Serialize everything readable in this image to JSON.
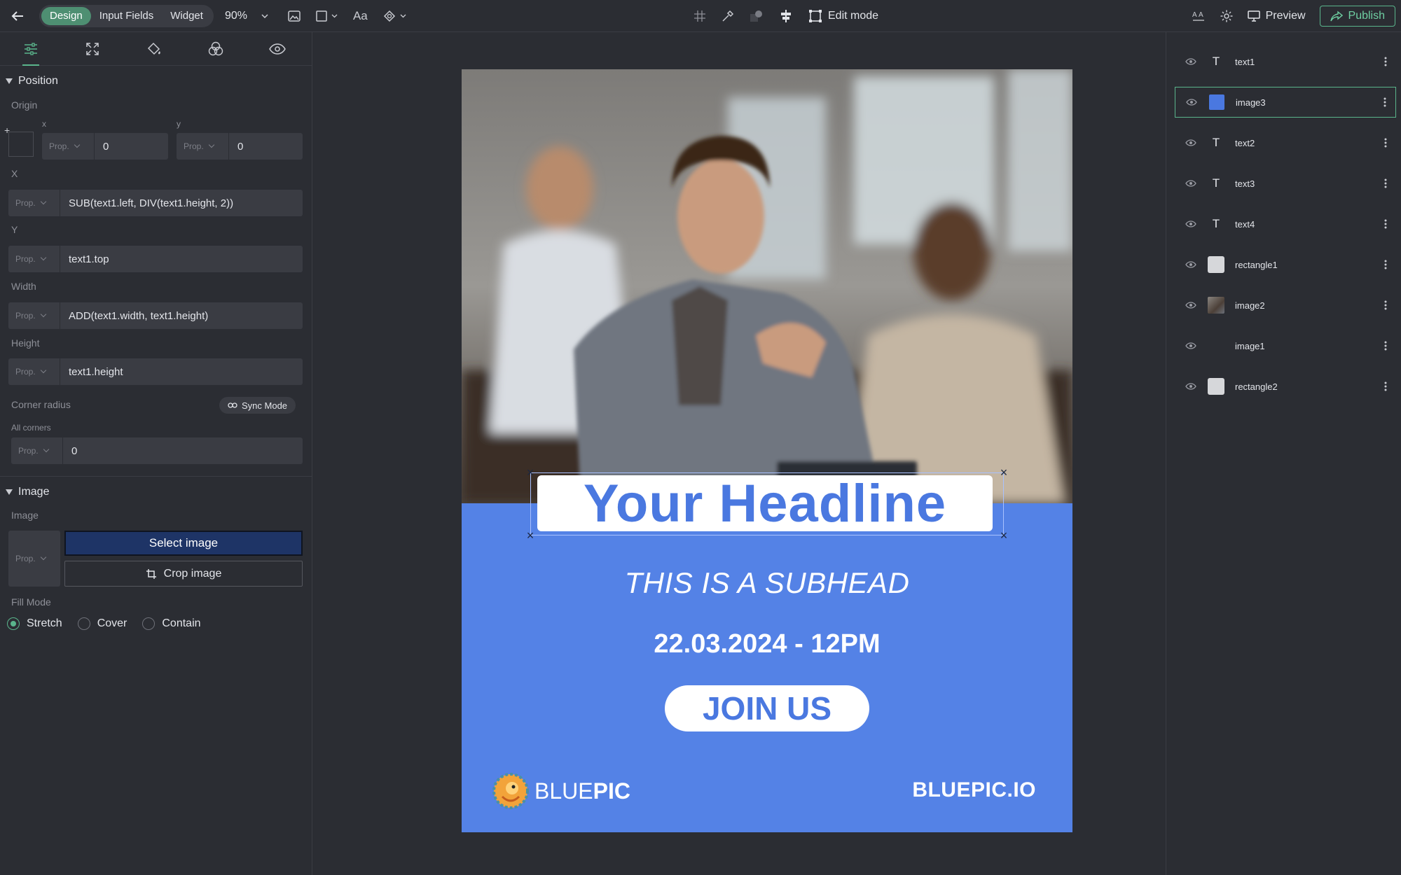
{
  "toolbar": {
    "modes": [
      "Design",
      "Input Fields",
      "Widget"
    ],
    "active_mode": "Design",
    "zoom": "90%",
    "font_tool": "Aa",
    "edit_mode_label": "Edit mode",
    "preview_label": "Preview",
    "publish_label": "Publish"
  },
  "left_panel": {
    "position_section": "Position",
    "origin_label": "Origin",
    "origin_x_label": "x",
    "origin_y_label": "y",
    "prop_label": "Prop.",
    "origin_x_value": "0",
    "origin_y_value": "0",
    "x_label": "X",
    "x_value": "SUB(text1.left, DIV(text1.height, 2))",
    "y_label": "Y",
    "y_value": "text1.top",
    "width_label": "Width",
    "width_value": "ADD(text1.width, text1.height)",
    "height_label": "Height",
    "height_value": "text1.height",
    "corner_radius_label": "Corner radius",
    "sync_mode_label": "Sync Mode",
    "all_corners_label": "All corners",
    "corner_value": "0",
    "image_section": "Image",
    "image_label": "Image",
    "select_image_label": "Select image",
    "crop_image_label": "Crop image",
    "fill_mode_label": "Fill Mode",
    "fill_modes": [
      "Stretch",
      "Cover",
      "Contain"
    ],
    "fill_mode_selected": "Stretch"
  },
  "poster": {
    "headline": "Your Headline",
    "subhead": "THIS IS A SUBHEAD",
    "datetime": "22.03.2024 - 12PM",
    "cta": "JOIN US",
    "brand_light": "BLUE",
    "brand_bold": "PIC",
    "brand_url": "BLUEPIC.IO",
    "background_color": "#5482e6"
  },
  "layers": [
    {
      "name": "text1",
      "type": "text"
    },
    {
      "name": "image3",
      "type": "color",
      "color": "#4a78e0",
      "selected": true
    },
    {
      "name": "text2",
      "type": "text"
    },
    {
      "name": "text3",
      "type": "text"
    },
    {
      "name": "text4",
      "type": "text"
    },
    {
      "name": "rectangle1",
      "type": "rect"
    },
    {
      "name": "image2",
      "type": "photo"
    },
    {
      "name": "image1",
      "type": "empty"
    },
    {
      "name": "rectangle2",
      "type": "rect"
    }
  ],
  "colors": {
    "accent": "#5ab58c",
    "panel_bg": "#2b2d33",
    "poster_blue": "#5482e6"
  }
}
